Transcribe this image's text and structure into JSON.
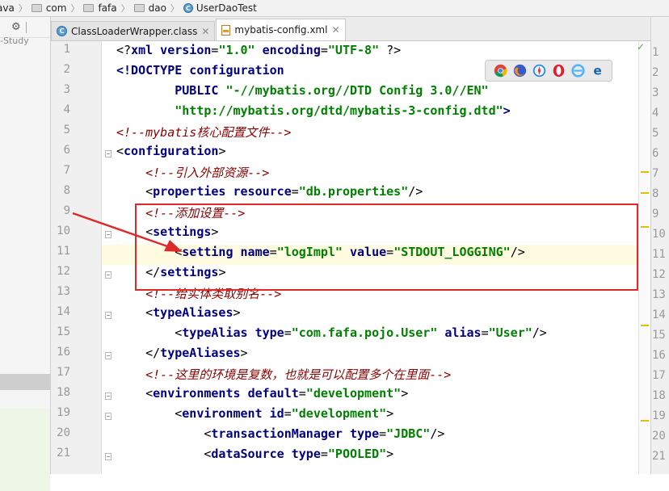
{
  "breadcrumb": {
    "items": [
      {
        "label": "ava",
        "icon": "none"
      },
      {
        "label": "com",
        "icon": "folder-icon"
      },
      {
        "label": "fafa",
        "icon": "folder-icon"
      },
      {
        "label": "dao",
        "icon": "folder-icon"
      },
      {
        "label": "UserDaoTest",
        "icon": "class-icon"
      }
    ],
    "separator": "〉"
  },
  "left_panel": {
    "toolbar_icon": "gear-icon",
    "label": "-Study"
  },
  "tabs": [
    {
      "label": "ClassLoaderWrapper.class",
      "icon": "class-file-icon",
      "active": false
    },
    {
      "label": "mybatis-config.xml",
      "icon": "xml-file-icon",
      "active": true
    }
  ],
  "editor": {
    "line_numbers": [
      "1",
      "2",
      "3",
      "4",
      "5",
      "6",
      "7",
      "8",
      "9",
      "10",
      "11",
      "12",
      "13",
      "14",
      "15",
      "16",
      "17",
      "18",
      "19",
      "20",
      "21"
    ],
    "lines": [
      [
        [
          "p",
          "<?"
        ],
        [
          "b",
          "xml version"
        ],
        [
          "p",
          "="
        ],
        [
          "s",
          "\"1.0\" "
        ],
        [
          "b",
          "encoding"
        ],
        [
          "p",
          "="
        ],
        [
          "s",
          "\"UTF-8\" "
        ],
        [
          "p",
          "?>"
        ]
      ],
      [
        [
          "d",
          "<!DOCTYPE configuration"
        ]
      ],
      [
        [
          "p",
          "        "
        ],
        [
          "d",
          "PUBLIC "
        ],
        [
          "s",
          "\"-//mybatis.org//DTD Config 3.0//EN\""
        ]
      ],
      [
        [
          "p",
          "        "
        ],
        [
          "s",
          "\"http://mybatis.org/dtd/mybatis-3-config.dtd\""
        ],
        [
          "d",
          ">"
        ]
      ],
      [
        [
          "r",
          "<!--mybatis核心配置文件-->"
        ]
      ],
      [
        [
          "p",
          "<"
        ],
        [
          "b",
          "configuration"
        ],
        [
          "p",
          ">"
        ]
      ],
      [
        [
          "p",
          "    "
        ],
        [
          "r",
          "<!--引入外部资源-->"
        ]
      ],
      [
        [
          "p",
          "    <"
        ],
        [
          "b",
          "properties "
        ],
        [
          "b",
          "resource"
        ],
        [
          "p",
          "="
        ],
        [
          "s",
          "\"db.properties\""
        ],
        [
          "p",
          "/>"
        ]
      ],
      [
        [
          "p",
          "    "
        ],
        [
          "r",
          "<!--添加设置-->"
        ]
      ],
      [
        [
          "p",
          "    <"
        ],
        [
          "b",
          "settings"
        ],
        [
          "p",
          ">"
        ]
      ],
      [
        [
          "p",
          "        <"
        ],
        [
          "b",
          "setting "
        ],
        [
          "b",
          "name"
        ],
        [
          "p",
          "="
        ],
        [
          "s",
          "\"logImpl\" "
        ],
        [
          "b",
          "value"
        ],
        [
          "p",
          "="
        ],
        [
          "s",
          "\"STDOUT_LOGGING\""
        ],
        [
          "p",
          "/>"
        ]
      ],
      [
        [
          "p",
          "    </"
        ],
        [
          "b",
          "settings"
        ],
        [
          "p",
          ">"
        ]
      ],
      [
        [
          "p",
          "    "
        ],
        [
          "r",
          "<!--给实体类取别名-->"
        ]
      ],
      [
        [
          "p",
          "    <"
        ],
        [
          "b",
          "typeAliases"
        ],
        [
          "p",
          ">"
        ]
      ],
      [
        [
          "p",
          "        <"
        ],
        [
          "b",
          "typeAlias "
        ],
        [
          "b",
          "type"
        ],
        [
          "p",
          "="
        ],
        [
          "s",
          "\"com.fafa.pojo.User\" "
        ],
        [
          "b",
          "alias"
        ],
        [
          "p",
          "="
        ],
        [
          "s",
          "\"User\""
        ],
        [
          "p",
          "/>"
        ]
      ],
      [
        [
          "p",
          "    </"
        ],
        [
          "b",
          "typeAliases"
        ],
        [
          "p",
          ">"
        ]
      ],
      [
        [
          "p",
          "    "
        ],
        [
          "r",
          "<!--这里的环境是复数，也就是可以配置多个在里面-->"
        ]
      ],
      [
        [
          "p",
          "    <"
        ],
        [
          "b",
          "environments "
        ],
        [
          "b",
          "default"
        ],
        [
          "p",
          "="
        ],
        [
          "s",
          "\"development\""
        ],
        [
          "p",
          ">"
        ]
      ],
      [
        [
          "p",
          "        <"
        ],
        [
          "b",
          "environment "
        ],
        [
          "b",
          "id"
        ],
        [
          "p",
          "="
        ],
        [
          "s",
          "\"development\""
        ],
        [
          "p",
          ">"
        ]
      ],
      [
        [
          "p",
          "            <"
        ],
        [
          "b",
          "transactionManager "
        ],
        [
          "b",
          "type"
        ],
        [
          "p",
          "="
        ],
        [
          "s",
          "\"JDBC\""
        ],
        [
          "p",
          "/>"
        ]
      ],
      [
        [
          "p",
          "            <"
        ],
        [
          "b",
          "dataSource "
        ],
        [
          "b",
          "type"
        ],
        [
          "p",
          "="
        ],
        [
          "s",
          "\"POOLED\""
        ],
        [
          "p",
          ">"
        ]
      ]
    ],
    "current_line": "11"
  },
  "right_panel": {
    "line_numbers": [
      "1",
      "2",
      "3",
      "4",
      "5",
      "6",
      "7",
      "8",
      "9",
      "10",
      "11",
      "12",
      "13",
      "14",
      "15",
      "16",
      "17",
      "18",
      "19",
      "20",
      "21"
    ]
  },
  "browser_icons": [
    "chrome-icon",
    "firefox-icon",
    "safari-icon",
    "opera-icon",
    "ie-icon",
    "edge-icon"
  ],
  "colors": {
    "tag_blue": "#000080",
    "value_green": "#008000",
    "comment_red": "#8b0000",
    "annotation_red": "#e02a2a",
    "current_line_bg": "#fffbe0"
  }
}
